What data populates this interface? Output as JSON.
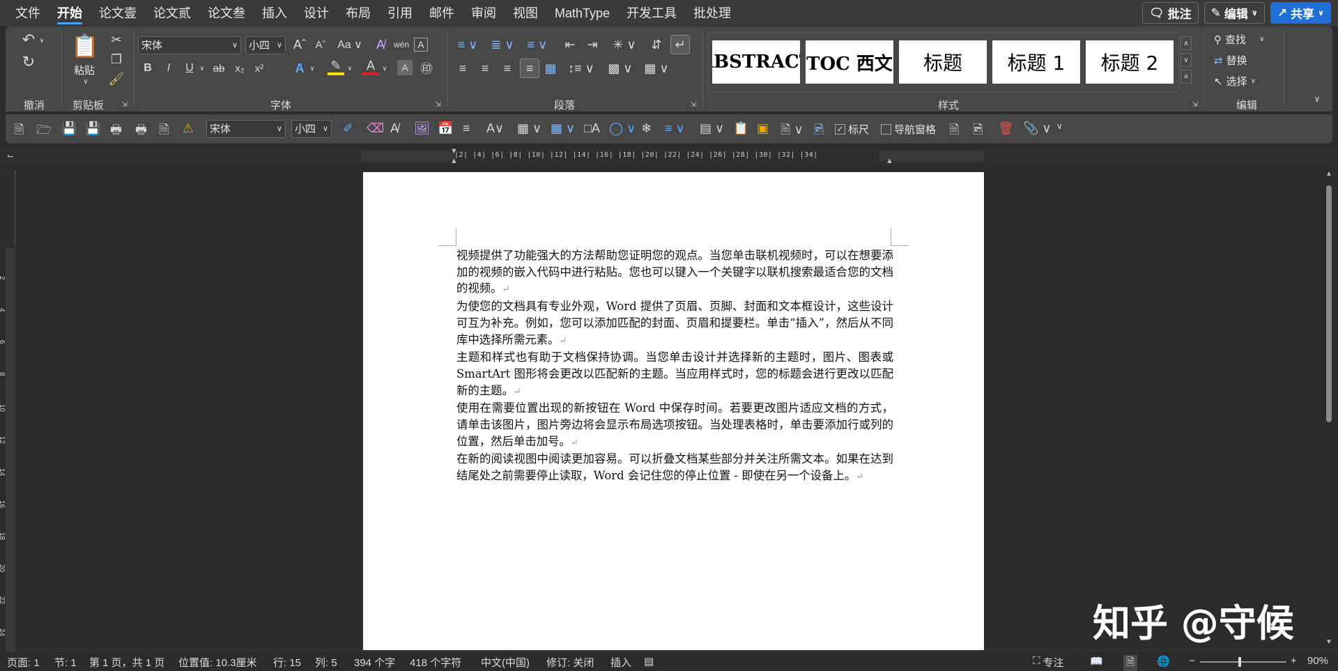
{
  "menu": {
    "tabs": [
      "文件",
      "开始",
      "论文壹",
      "论文贰",
      "论文叁",
      "插入",
      "设计",
      "布局",
      "引用",
      "邮件",
      "审阅",
      "视图",
      "MathType",
      "开发工具",
      "批处理"
    ],
    "active": "开始"
  },
  "top_right": {
    "comment": "批注",
    "edit": "编辑",
    "share": "共享"
  },
  "ribbon": {
    "undo_label": "撤消",
    "clipboard_label": "剪贴板",
    "paste_label": "粘贴",
    "font_label": "字体",
    "paragraph_label": "段落",
    "styles_label": "样式",
    "editing_label": "编辑",
    "font_name": "宋体",
    "font_size": "小四",
    "styles": [
      "ABSTRACT",
      "TOC 西文",
      "标题",
      "标题 1",
      "标题 2"
    ],
    "find": "查找",
    "replace": "替换",
    "select": "选择"
  },
  "qat": {
    "font_name": "宋体",
    "font_size": "小四",
    "ruler_check": "标尺",
    "nav_pane_check": "导航窗格"
  },
  "ruler": {
    "h_ticks": "|2| |4| |6| |8| |10| |12| |14| |16| |18| |20| |22| |24| |26| |28| |30| |32| |34|",
    "v_labels": [
      "2",
      "4",
      "6",
      "8",
      "10",
      "12",
      "14",
      "16",
      "18",
      "20",
      "22",
      "24"
    ]
  },
  "document": {
    "paragraphs": [
      "视频提供了功能强大的方法帮助您证明您的观点。当您单击联机视频时，可以在想要添加的视频的嵌入代码中进行粘贴。您也可以键入一个关键字以联机搜索最适合您的文档的视频。",
      "为使您的文档具有专业外观，Word 提供了页眉、页脚、封面和文本框设计，这些设计可互为补充。例如，您可以添加匹配的封面、页眉和提要栏。单击“插入”，然后从不同库中选择所需元素。",
      "主题和样式也有助于文档保持协调。当您单击设计并选择新的主题时，图片、图表或 SmartArt 图形将会更改以匹配新的主题。当应用样式时，您的标题会进行更改以匹配新的主题。",
      "使用在需要位置出现的新按钮在 Word 中保存时间。若要更改图片适应文档的方式，请单击该图片，图片旁边将会显示布局选项按钮。当处理表格时，单击要添加行或列的位置，然后单击加号。",
      "在新的阅读视图中阅读更加容易。可以折叠文档某些部分并关注所需文本。如果在达到结尾处之前需要停止读取，Word 会记住您的停止位置 - 即使在另一个设备上。"
    ],
    "pilcrow": "↵"
  },
  "watermark": "知乎 @守候",
  "status": {
    "page": "页面: 1",
    "section": "节: 1",
    "pages": "第 1 页，共 1 页",
    "position": "位置值: 10.3厘米",
    "row": "行: 15",
    "col": "列: 5",
    "words": "394 个字",
    "chars": "418 个字符",
    "lang": "中文(中国)",
    "track": "修订: 关闭",
    "insert": "插入",
    "focus": "专注",
    "zoom": "90%"
  }
}
